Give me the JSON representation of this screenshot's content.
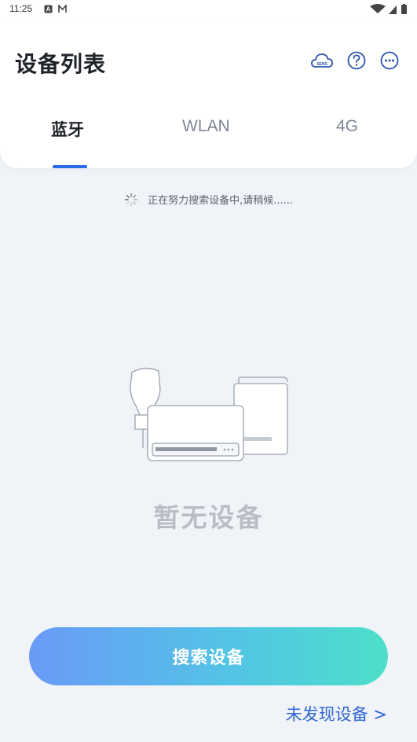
{
  "status_bar": {
    "time": "11:25",
    "left_icons": [
      "a-box-icon",
      "m-notif-icon"
    ],
    "right_icons": [
      "wifi-icon",
      "signal-icon",
      "battery-icon"
    ]
  },
  "header": {
    "title": "设备列表",
    "actions": [
      "cloud-sens-icon",
      "help-icon",
      "more-icon"
    ],
    "cloud_badge_text": "SENS"
  },
  "tabs": [
    {
      "label": "蓝牙",
      "active": true
    },
    {
      "label": "WLAN",
      "active": false
    },
    {
      "label": "4G",
      "active": false
    }
  ],
  "search_status": "正在努力搜索设备中,请稍候......",
  "empty_state": {
    "message": "暂无设备",
    "illustration": "devices-illustration"
  },
  "primary_button": "搜索设备",
  "not_found_link": "未发现设备 >",
  "colors": {
    "accent": "#2a6be8",
    "link": "#2e66d4",
    "gradient_start": "#6a9af7",
    "gradient_end": "#4ddfc9",
    "background": "#f0f3f7"
  }
}
